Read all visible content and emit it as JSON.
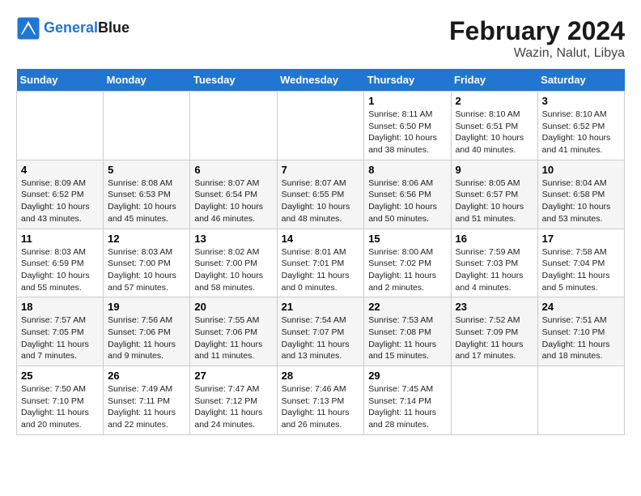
{
  "logo": {
    "text_general": "General",
    "text_blue": "Blue"
  },
  "title": "February 2024",
  "subtitle": "Wazin, Nalut, Libya",
  "days_header": [
    "Sunday",
    "Monday",
    "Tuesday",
    "Wednesday",
    "Thursday",
    "Friday",
    "Saturday"
  ],
  "weeks": [
    [
      {
        "day": "",
        "sunrise": "",
        "sunset": "",
        "daylight": ""
      },
      {
        "day": "",
        "sunrise": "",
        "sunset": "",
        "daylight": ""
      },
      {
        "day": "",
        "sunrise": "",
        "sunset": "",
        "daylight": ""
      },
      {
        "day": "",
        "sunrise": "",
        "sunset": "",
        "daylight": ""
      },
      {
        "day": "1",
        "sunrise": "8:11 AM",
        "sunset": "6:50 PM",
        "daylight": "10 hours and 38 minutes."
      },
      {
        "day": "2",
        "sunrise": "8:10 AM",
        "sunset": "6:51 PM",
        "daylight": "10 hours and 40 minutes."
      },
      {
        "day": "3",
        "sunrise": "8:10 AM",
        "sunset": "6:52 PM",
        "daylight": "10 hours and 41 minutes."
      }
    ],
    [
      {
        "day": "4",
        "sunrise": "8:09 AM",
        "sunset": "6:52 PM",
        "daylight": "10 hours and 43 minutes."
      },
      {
        "day": "5",
        "sunrise": "8:08 AM",
        "sunset": "6:53 PM",
        "daylight": "10 hours and 45 minutes."
      },
      {
        "day": "6",
        "sunrise": "8:07 AM",
        "sunset": "6:54 PM",
        "daylight": "10 hours and 46 minutes."
      },
      {
        "day": "7",
        "sunrise": "8:07 AM",
        "sunset": "6:55 PM",
        "daylight": "10 hours and 48 minutes."
      },
      {
        "day": "8",
        "sunrise": "8:06 AM",
        "sunset": "6:56 PM",
        "daylight": "10 hours and 50 minutes."
      },
      {
        "day": "9",
        "sunrise": "8:05 AM",
        "sunset": "6:57 PM",
        "daylight": "10 hours and 51 minutes."
      },
      {
        "day": "10",
        "sunrise": "8:04 AM",
        "sunset": "6:58 PM",
        "daylight": "10 hours and 53 minutes."
      }
    ],
    [
      {
        "day": "11",
        "sunrise": "8:03 AM",
        "sunset": "6:59 PM",
        "daylight": "10 hours and 55 minutes."
      },
      {
        "day": "12",
        "sunrise": "8:03 AM",
        "sunset": "7:00 PM",
        "daylight": "10 hours and 57 minutes."
      },
      {
        "day": "13",
        "sunrise": "8:02 AM",
        "sunset": "7:00 PM",
        "daylight": "10 hours and 58 minutes."
      },
      {
        "day": "14",
        "sunrise": "8:01 AM",
        "sunset": "7:01 PM",
        "daylight": "11 hours and 0 minutes."
      },
      {
        "day": "15",
        "sunrise": "8:00 AM",
        "sunset": "7:02 PM",
        "daylight": "11 hours and 2 minutes."
      },
      {
        "day": "16",
        "sunrise": "7:59 AM",
        "sunset": "7:03 PM",
        "daylight": "11 hours and 4 minutes."
      },
      {
        "day": "17",
        "sunrise": "7:58 AM",
        "sunset": "7:04 PM",
        "daylight": "11 hours and 5 minutes."
      }
    ],
    [
      {
        "day": "18",
        "sunrise": "7:57 AM",
        "sunset": "7:05 PM",
        "daylight": "11 hours and 7 minutes."
      },
      {
        "day": "19",
        "sunrise": "7:56 AM",
        "sunset": "7:06 PM",
        "daylight": "11 hours and 9 minutes."
      },
      {
        "day": "20",
        "sunrise": "7:55 AM",
        "sunset": "7:06 PM",
        "daylight": "11 hours and 11 minutes."
      },
      {
        "day": "21",
        "sunrise": "7:54 AM",
        "sunset": "7:07 PM",
        "daylight": "11 hours and 13 minutes."
      },
      {
        "day": "22",
        "sunrise": "7:53 AM",
        "sunset": "7:08 PM",
        "daylight": "11 hours and 15 minutes."
      },
      {
        "day": "23",
        "sunrise": "7:52 AM",
        "sunset": "7:09 PM",
        "daylight": "11 hours and 17 minutes."
      },
      {
        "day": "24",
        "sunrise": "7:51 AM",
        "sunset": "7:10 PM",
        "daylight": "11 hours and 18 minutes."
      }
    ],
    [
      {
        "day": "25",
        "sunrise": "7:50 AM",
        "sunset": "7:10 PM",
        "daylight": "11 hours and 20 minutes."
      },
      {
        "day": "26",
        "sunrise": "7:49 AM",
        "sunset": "7:11 PM",
        "daylight": "11 hours and 22 minutes."
      },
      {
        "day": "27",
        "sunrise": "7:47 AM",
        "sunset": "7:12 PM",
        "daylight": "11 hours and 24 minutes."
      },
      {
        "day": "28",
        "sunrise": "7:46 AM",
        "sunset": "7:13 PM",
        "daylight": "11 hours and 26 minutes."
      },
      {
        "day": "29",
        "sunrise": "7:45 AM",
        "sunset": "7:14 PM",
        "daylight": "11 hours and 28 minutes."
      },
      {
        "day": "",
        "sunrise": "",
        "sunset": "",
        "daylight": ""
      },
      {
        "day": "",
        "sunrise": "",
        "sunset": "",
        "daylight": ""
      }
    ]
  ]
}
